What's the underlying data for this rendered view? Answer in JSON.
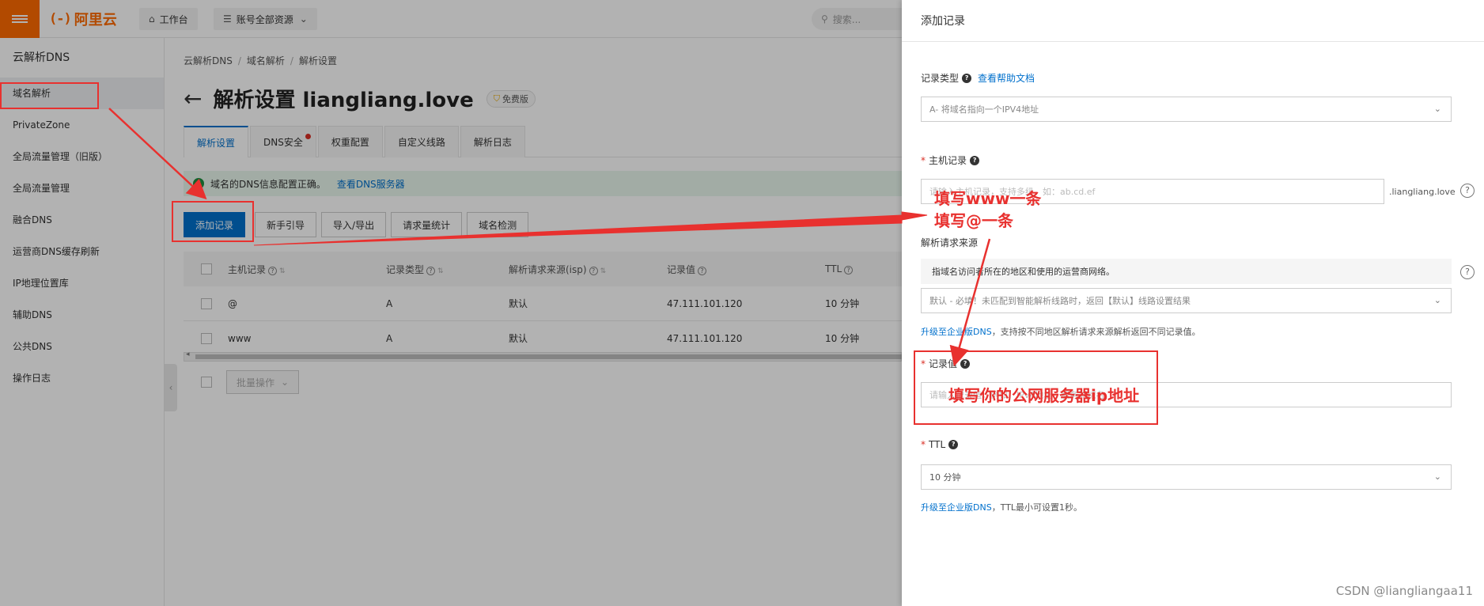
{
  "topbar": {
    "logo_text": "阿里云",
    "workbench": "工作台",
    "resources": "账号全部资源",
    "search_placeholder": "搜索..."
  },
  "sidebar": {
    "title": "云解析DNS",
    "items": [
      {
        "label": "域名解析"
      },
      {
        "label": "PrivateZone"
      },
      {
        "label": "全局流量管理（旧版）"
      },
      {
        "label": "全局流量管理"
      },
      {
        "label": "融合DNS"
      },
      {
        "label": "运营商DNS缓存刷新"
      },
      {
        "label": "IP地理位置库"
      },
      {
        "label": "辅助DNS"
      },
      {
        "label": "公共DNS"
      },
      {
        "label": "操作日志"
      }
    ]
  },
  "main": {
    "breadcrumb": [
      "云解析DNS",
      "域名解析",
      "解析设置"
    ],
    "title": "解析设置 liangliang.love",
    "badge": "免费版",
    "tabs": [
      {
        "label": "解析设置"
      },
      {
        "label": "DNS安全"
      },
      {
        "label": "权重配置"
      },
      {
        "label": "自定义线路"
      },
      {
        "label": "解析日志"
      }
    ],
    "notice": "域名的DNS信息配置正确。",
    "notice_link": "查看DNS服务器",
    "toolbar": [
      "添加记录",
      "新手引导",
      "导入/导出",
      "请求量统计",
      "域名检测"
    ],
    "columns": [
      "主机记录",
      "记录类型",
      "解析请求来源(isp)",
      "记录值",
      "TTL"
    ],
    "rows": [
      [
        "@",
        "A",
        "默认",
        "47.111.101.120",
        "10 分钟"
      ],
      [
        "www",
        "A",
        "默认",
        "47.111.101.120",
        "10 分钟"
      ]
    ],
    "bulk": "批量操作"
  },
  "drawer": {
    "title": "添加记录",
    "record_type_label": "记录类型",
    "help_doc": "查看帮助文档",
    "record_type_value": "A- 将域名指向一个IPV4地址",
    "host_label": "主机记录",
    "host_placeholder": "请输入主机记录，支持多级，如：ab.cd.ef",
    "host_suffix": ".liangliang.love",
    "source_label": "解析请求来源",
    "source_tip": "指域名访问者所在的地区和使用的运营商网络。",
    "source_value": "默认 - 必填！未匹配到智能解析线路时，返回【默认】线路设置结果",
    "source_desc_link": "升级至企业版DNS",
    "source_desc": "，支持按不同地区解析请求来源解析返回不同记录值。",
    "value_label": "记录值",
    "value_placeholder": "请输入记录值，例如：IPv4地址、服务器域名",
    "ttl_label": "TTL",
    "ttl_value": "10 分钟",
    "ttl_desc_link": "升级至企业版DNS",
    "ttl_desc": "，TTL最小可设置1秒。"
  },
  "annotations": {
    "host_note_1": "填写www一条",
    "host_note_2": "填写@一条",
    "value_note": "填写你的公网服务器ip地址",
    "color": "#e8312f"
  },
  "watermark": "CSDN @liangliangaa11"
}
